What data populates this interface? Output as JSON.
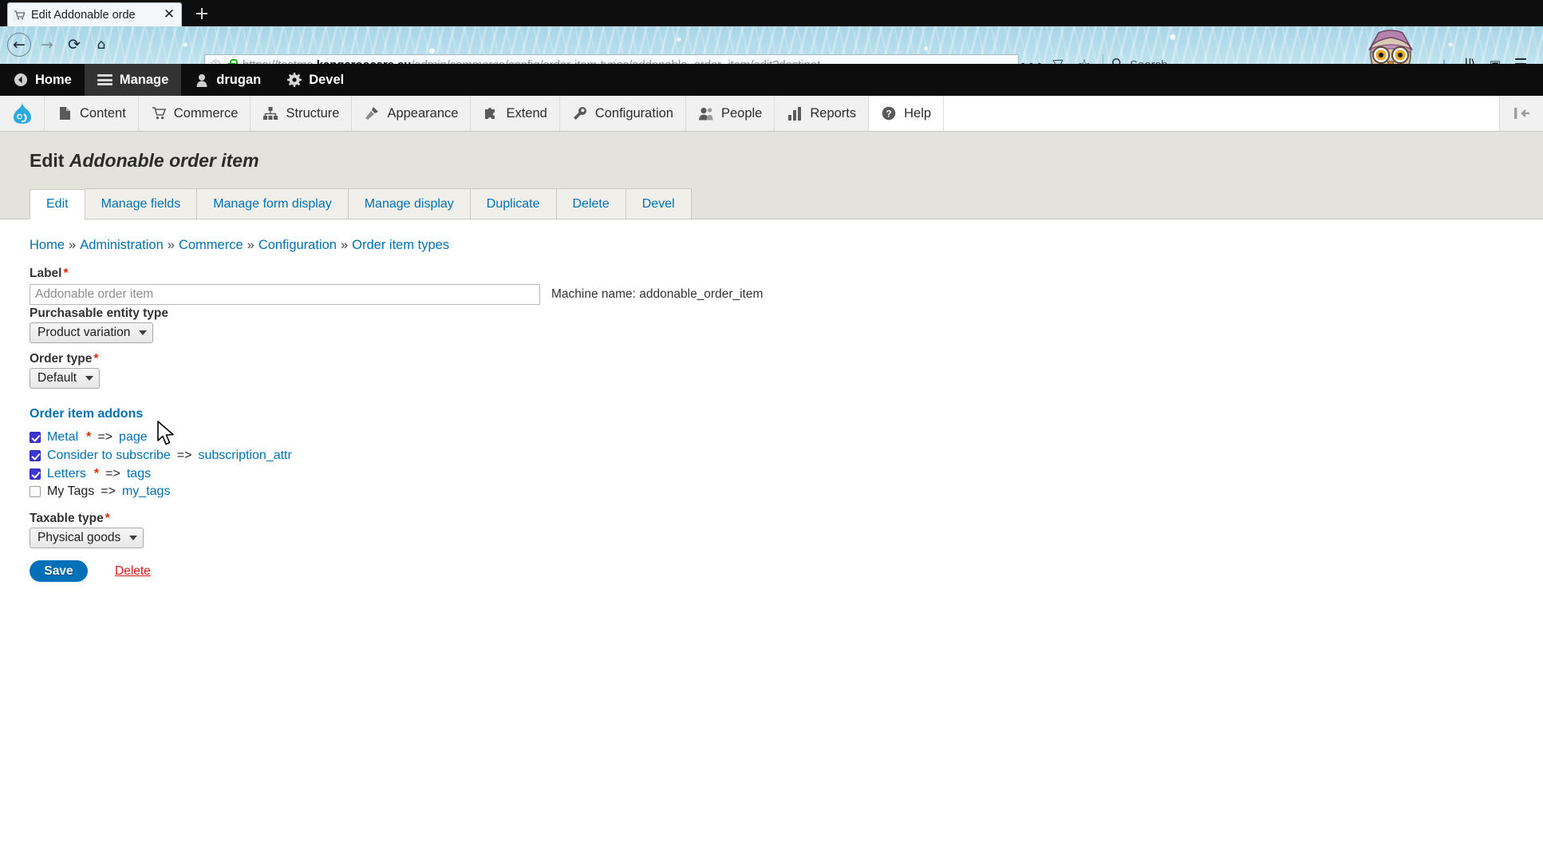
{
  "browser": {
    "tab": {
      "title": "Edit Addonable orde",
      "favicon_icon": "shopping-cart-favicon",
      "close_icon": "✕"
    },
    "new_tab_label": "+",
    "nav": {
      "back_icon": "←",
      "forward_icon": "→",
      "reload_icon": "⟳",
      "home_icon": "⌂"
    },
    "url": {
      "info_icon": "ⓘ",
      "lock_icon": "padlock-icon",
      "scheme": "https://testme.",
      "domain": "kangaroocare.eu",
      "path": "/admin/commerce/config/order-item-types/addonable_order_item/edit?destinat",
      "more_icon": "•••",
      "pocket_icon": "▽",
      "star_icon": "☆"
    },
    "search": {
      "icon": "search-icon",
      "placeholder": "Search"
    },
    "right_buttons": {
      "download_icon": "⤓",
      "library_icon": "||\\",
      "sidebar_icon": "▣",
      "menu_icon": "☰"
    }
  },
  "admin_toolbar": {
    "items": [
      {
        "label": "Home",
        "icon": "back-home-icon",
        "active": false
      },
      {
        "label": "Manage",
        "icon": "hamburger-icon",
        "active": true
      },
      {
        "label": "drugan",
        "icon": "user-icon",
        "active": false
      },
      {
        "label": "Devel",
        "icon": "gear-icon",
        "active": false
      }
    ]
  },
  "menu_bar": {
    "logo_icon": "drupal-logo",
    "items": [
      {
        "label": "Content",
        "icon": "file-icon"
      },
      {
        "label": "Commerce",
        "icon": "cart-icon"
      },
      {
        "label": "Structure",
        "icon": "structure-icon"
      },
      {
        "label": "Appearance",
        "icon": "paintbrush-icon"
      },
      {
        "label": "Extend",
        "icon": "puzzle-icon"
      },
      {
        "label": "Configuration",
        "icon": "wrench-icon"
      },
      {
        "label": "People",
        "icon": "people-icon"
      },
      {
        "label": "Reports",
        "icon": "bar-chart-icon"
      },
      {
        "label": "Help",
        "icon": "question-icon"
      }
    ],
    "orientation_icon": "toolbar-orientation-icon"
  },
  "page": {
    "title_prefix": "Edit",
    "title_entity": "Addonable order item",
    "tabs": [
      {
        "label": "Edit",
        "active": true
      },
      {
        "label": "Manage fields",
        "active": false
      },
      {
        "label": "Manage form display",
        "active": false
      },
      {
        "label": "Manage display",
        "active": false
      },
      {
        "label": "Duplicate",
        "active": false
      },
      {
        "label": "Delete",
        "active": false
      },
      {
        "label": "Devel",
        "active": false
      }
    ],
    "breadcrumb": [
      "Home",
      "Administration",
      "Commerce",
      "Configuration",
      "Order item types"
    ],
    "breadcrumb_separator": "»"
  },
  "form": {
    "label_field": {
      "label": "Label",
      "required_mark": "*",
      "value": "Addonable order item",
      "placeholder": "Addonable order item"
    },
    "machine_name": "Machine name: addonable_order_item",
    "purchasable_entity_type": {
      "label": "Purchasable entity type",
      "value": "Product variation"
    },
    "order_type": {
      "label": "Order type",
      "required_mark": "*",
      "value": "Default"
    },
    "addons": {
      "title": "Order item addons",
      "items": [
        {
          "checked": true,
          "label": "Metal",
          "required_mark": "*",
          "arrow": "=>",
          "machine": "page",
          "label_is_link": true,
          "machine_is_link": true
        },
        {
          "checked": true,
          "label": "Consider to subscribe",
          "required_mark": "",
          "arrow": "=>",
          "machine": "subscription_attr",
          "label_is_link": true,
          "machine_is_link": true
        },
        {
          "checked": true,
          "label": "Letters",
          "required_mark": "*",
          "arrow": "=>",
          "machine": "tags",
          "label_is_link": true,
          "machine_is_link": true
        },
        {
          "checked": false,
          "label": "My Tags",
          "required_mark": "",
          "arrow": "=>",
          "machine": "my_tags",
          "label_is_link": false,
          "machine_is_link": true
        }
      ]
    },
    "taxable_type": {
      "label": "Taxable type",
      "required_mark": "*",
      "value": "Physical goods"
    },
    "save_label": "Save",
    "delete_label": "Delete"
  },
  "colors": {
    "link": "#0071b3",
    "required": "#e32700",
    "save_button": "#0071b8",
    "delete_link": "#d81616",
    "checkbox_checked": "#3b35d6",
    "toolbar_bg": "#0d0d0d",
    "page_head_bg": "#e3e2dc"
  }
}
